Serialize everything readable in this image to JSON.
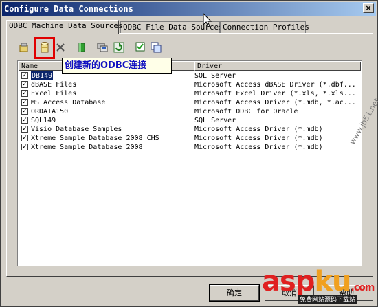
{
  "window": {
    "title": "Configure Data Connections",
    "close_glyph": "×"
  },
  "tabs": [
    {
      "label": "ODBC Machine Data Sources",
      "active": true
    },
    {
      "label": "ODBC File Data Sources",
      "active": false
    },
    {
      "label": "Connection Profiles",
      "active": false
    }
  ],
  "toolbar": {
    "buttons": [
      "configure-dsn-icon",
      "new-dsn-icon",
      "delete-icon",
      "test-connection-icon",
      "odbc-admin-icon",
      "refresh-icon",
      "select-all-icon",
      "copy-icon"
    ]
  },
  "callout": {
    "text": "创建新的ODBC连接"
  },
  "list": {
    "columns": [
      "Name",
      "Driver"
    ],
    "rows": [
      {
        "checked": true,
        "name": "DB149",
        "driver": "SQL Server",
        "selected": true
      },
      {
        "checked": true,
        "name": "dBASE Files",
        "driver": "Microsoft Access dBASE Driver (*.dbf..."
      },
      {
        "checked": true,
        "name": "Excel Files",
        "driver": "Microsoft Excel Driver (*.xls, *.xls..."
      },
      {
        "checked": true,
        "name": "MS Access Database",
        "driver": "Microsoft Access Driver (*.mdb, *.ac..."
      },
      {
        "checked": true,
        "name": "ORDATA150",
        "driver": "Microsoft ODBC for Oracle"
      },
      {
        "checked": true,
        "name": "SQL149",
        "driver": "SQL Server"
      },
      {
        "checked": true,
        "name": "Visio Database Samples",
        "driver": "Microsoft Access Driver (*.mdb)"
      },
      {
        "checked": true,
        "name": "Xtreme Sample Database 2008 CHS",
        "driver": "Microsoft Access Driver (*.mdb)"
      },
      {
        "checked": true,
        "name": "Xtreme Sample Database 2008",
        "driver": "Microsoft Access Driver (*.mdb)"
      }
    ]
  },
  "buttons": {
    "ok": "确定",
    "cancel": "取消",
    "help": "帮助"
  },
  "watermark": {
    "side": "www.jb51.net",
    "logo_main": "asp",
    "logo_accent": "ku",
    "logo_suffix": ".com",
    "sub": "免费网站源码下载站"
  }
}
